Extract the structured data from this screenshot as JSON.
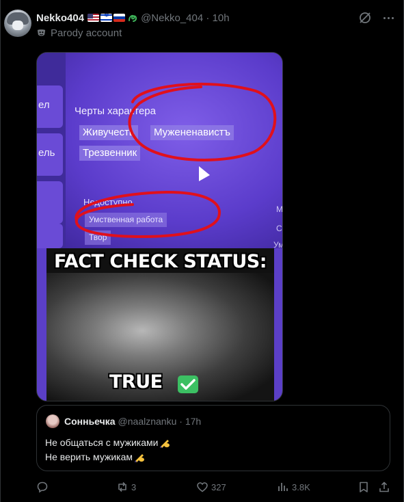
{
  "post": {
    "display_name": "Nekko404",
    "handle_time": "@Nekko_404 · 10h",
    "parody_label": "Parody account",
    "flags": [
      "flag-us-icon",
      "flag-il-icon",
      "flag-ru-icon"
    ]
  },
  "media": {
    "screenshot": {
      "heading": "Черты характера",
      "traits": [
        "Живучесть",
        "Мужененавистъ",
        "Трезвенник"
      ],
      "unavailable_label": "Недоступно",
      "unavailable_items": [
        "Умственная работа",
        "Твор"
      ],
      "sidebar_labels": [
        "ел",
        "ель"
      ],
      "edge_letters": [
        "М",
        "С",
        "Ум"
      ]
    },
    "meme": {
      "top_caption": "FACT CHECK STATUS:",
      "bottom_caption": "TRUE"
    }
  },
  "quote": {
    "name": "Сонньечка",
    "handle_time": "@naalznanku · 17h",
    "line1": "Не общаться с мужиками",
    "line2": "Не верить мужикам"
  },
  "actions": {
    "replies": "",
    "reposts": "3",
    "likes": "327",
    "views": "3.8K"
  },
  "colors": {
    "background": "#000000",
    "secondary_text": "#71767b",
    "border": "#2f3336",
    "annotation_red": "#e0101c",
    "game_purple": "#5b3fc7"
  }
}
